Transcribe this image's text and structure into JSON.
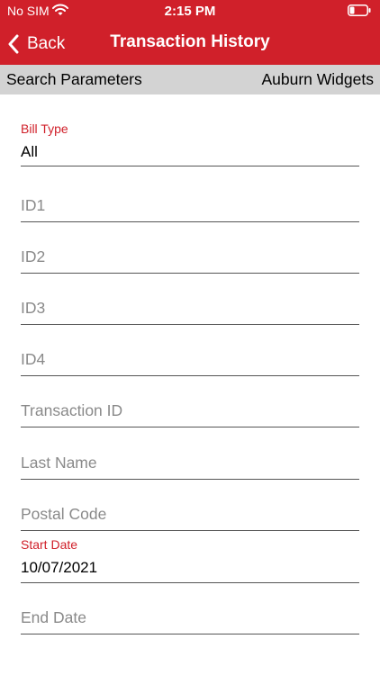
{
  "status_bar": {
    "carrier": "No SIM",
    "time": "2:15 PM"
  },
  "nav": {
    "back_label": "Back",
    "title": "Transaction History"
  },
  "subheader": {
    "left_label": "Search Parameters",
    "right_label": "Auburn Widgets"
  },
  "form": {
    "bill_type": {
      "label": "Bill Type",
      "value": "All"
    },
    "id1": {
      "placeholder": "ID1"
    },
    "id2": {
      "placeholder": "ID2"
    },
    "id3": {
      "placeholder": "ID3"
    },
    "id4": {
      "placeholder": "ID4"
    },
    "transaction_id": {
      "placeholder": "Transaction ID"
    },
    "last_name": {
      "placeholder": "Last Name"
    },
    "postal_code": {
      "placeholder": "Postal Code"
    },
    "start_date": {
      "label": "Start Date",
      "value": "10/07/2021"
    },
    "end_date": {
      "placeholder": "End Date"
    }
  },
  "colors": {
    "brand_red": "#d0202a",
    "subheader_gray": "#d3d3d3",
    "placeholder_gray": "#8a8a8a"
  }
}
